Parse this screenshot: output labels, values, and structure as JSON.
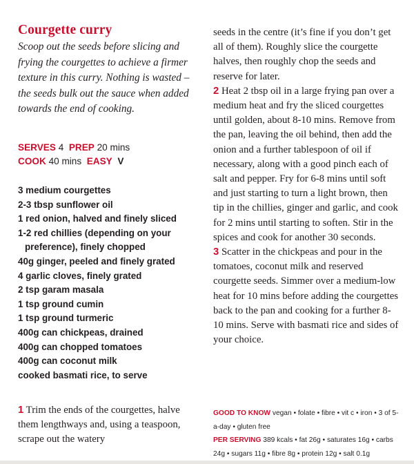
{
  "recipe": {
    "title": "Courgette curry",
    "intro": "Scoop out the seeds before slicing and frying the courgettes to achieve a firmer texture in this curry. Nothing is wasted – the seeds bulk out the sauce when added towards the end of cooking.",
    "serves_label": "SERVES",
    "serves_value": "4",
    "prep_label": "PREP",
    "prep_value": "20 mins",
    "cook_label": "COOK",
    "cook_value": "40 mins",
    "easy_label": "EASY",
    "vegan_mark": "V"
  },
  "ingredients": [
    "3 medium courgettes",
    "2-3 tbsp sunflower oil",
    "1 red onion, halved and finely sliced",
    "1-2 red chillies (depending on your preference), finely chopped",
    "40g ginger, peeled and finely grated",
    "4 garlic cloves, finely grated",
    "2 tsp garam masala",
    "1 tsp ground cumin",
    "1 tsp ground turmeric",
    "400g can chickpeas, drained",
    "400g can chopped tomatoes",
    "400g can coconut milk",
    "cooked basmati rice, to serve"
  ],
  "method": [
    {
      "num": "1",
      "text_left": "Trim the ends of the courgettes, halve them lengthways and, using a teaspoon, scrape out the watery",
      "text_right": "seeds in the centre (it’s fine if you don’t get all of them). Roughly slice the courgette halves, then roughly chop the seeds and reserve for later."
    },
    {
      "num": "2",
      "text": "Heat 2 tbsp oil in a large frying pan over a medium heat and fry the sliced courgettes until golden, about 8-10 mins. Remove from the pan, leaving the oil behind, then add the onion and a further tablespoon of oil if necessary, along with a good pinch each of salt and pepper. Fry for 6-8 mins until soft and just starting to turn a light brown, then tip in the chillies, ginger and garlic, and cook for 2 mins until starting to soften. Stir in the spices and cook for another 30 seconds."
    },
    {
      "num": "3",
      "text": "Scatter in the chickpeas and pour in the tomatoes, coconut milk and reserved courgette seeds. Simmer over a medium-low heat for 10 mins before adding the courgettes back to the pan and cooking for a further 8-10 mins. Serve with basmati rice and sides of your choice."
    }
  ],
  "nutrition": {
    "good_to_know_label": "GOOD TO KNOW",
    "good_to_know_text": "vegan • folate • fibre • vit c • iron • 3 of 5-a-day • gluten free",
    "per_serving_label": "PER SERVING",
    "per_serving_text": "389 kcals • fat 26g • saturates 16g • carbs 24g • sugars 11g • fibre 8g • protein 12g • salt 0.1g"
  }
}
